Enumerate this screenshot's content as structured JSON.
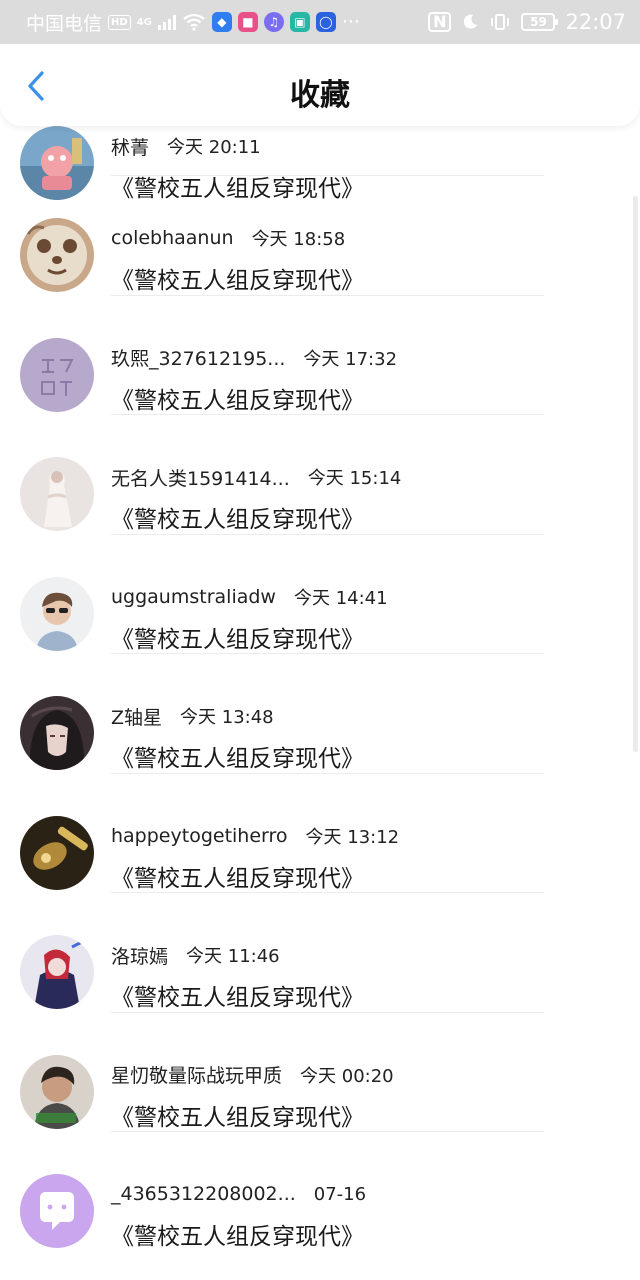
{
  "status_bar": {
    "carrier": "中国电信",
    "hd": "HD",
    "network": "4G",
    "battery": "59",
    "time": "22:07",
    "more": "···"
  },
  "nav": {
    "title": "收藏",
    "back_icon": "chevron-left-icon"
  },
  "colors": {
    "accent": "#3a8fe8",
    "divider": "#ececec",
    "status_bar_bg": "#dcdcdc"
  },
  "items": [
    {
      "name": "秫菁",
      "time": "今天 20:11",
      "title": "《警校五人组反穿现代》"
    },
    {
      "name": "colebhaanun",
      "time": "今天 18:58",
      "title": "《警校五人组反穿现代》"
    },
    {
      "name": "玖熙_327612195...",
      "time": "今天 17:32",
      "title": "《警校五人组反穿现代》"
    },
    {
      "name": "无名人类1591414...",
      "time": "今天 15:14",
      "title": "《警校五人组反穿现代》"
    },
    {
      "name": "uggaumstraliadw",
      "time": "今天 14:41",
      "title": "《警校五人组反穿现代》"
    },
    {
      "name": "Z轴星",
      "time": "今天 13:48",
      "title": "《警校五人组反穿现代》"
    },
    {
      "name": "happeytogetiherro",
      "time": "今天 13:12",
      "title": "《警校五人组反穿现代》"
    },
    {
      "name": "洛琼嫣",
      "time": "今天 11:46",
      "title": "《警校五人组反穿现代》"
    },
    {
      "name": "星忉敬量际战玩甲质",
      "time": "今天 00:20",
      "title": "《警校五人组反穿现代》"
    },
    {
      "name": "_4365312208002...",
      "time": "07-16",
      "title": "《警校五人组反穿现代》"
    }
  ]
}
